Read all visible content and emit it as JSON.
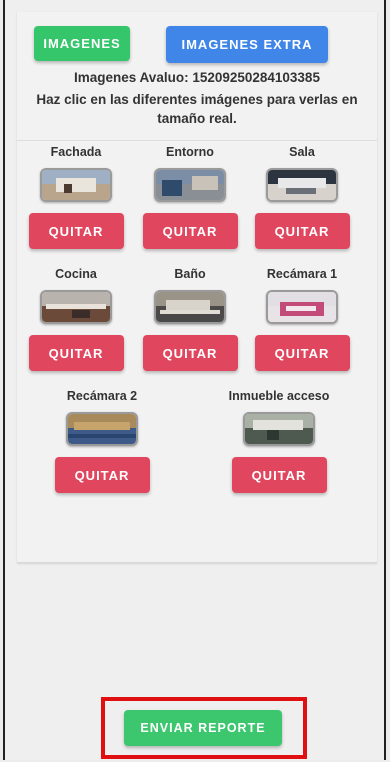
{
  "header": {
    "images_button": "IMAGENES",
    "extra_images_button": "IMAGENES EXTRA"
  },
  "info": {
    "avaluo_line": "Imagenes Avaluo: 15209250284103385",
    "hint_line1": "Haz clic en las diferentes imágenes para verlas en",
    "hint_line2": "tamaño real."
  },
  "images": [
    {
      "label": "Fachada",
      "remove_label": "QUITAR",
      "thumb_icon": "house-facade-photo"
    },
    {
      "label": "Entorno",
      "remove_label": "QUITAR",
      "thumb_icon": "street-photo"
    },
    {
      "label": "Sala",
      "remove_label": "QUITAR",
      "thumb_icon": "living-room-photo"
    },
    {
      "label": "Cocina",
      "remove_label": "QUITAR",
      "thumb_icon": "kitchen-photo"
    },
    {
      "label": "Baño",
      "remove_label": "QUITAR",
      "thumb_icon": "bathroom-photo"
    },
    {
      "label": "Recámara 1",
      "remove_label": "QUITAR",
      "thumb_icon": "bedroom-photo"
    },
    {
      "label": "Recámara 2",
      "remove_label": "QUITAR",
      "thumb_icon": "bedroom-photo"
    },
    {
      "label": "Inmueble acceso",
      "remove_label": "QUITAR",
      "thumb_icon": "access-photo"
    }
  ],
  "footer": {
    "send_report_button": "ENVIAR REPORTE"
  },
  "colors": {
    "green": "#35c56a",
    "blue": "#3f86e8",
    "red": "#e0475f",
    "highlight": "#e01010"
  }
}
